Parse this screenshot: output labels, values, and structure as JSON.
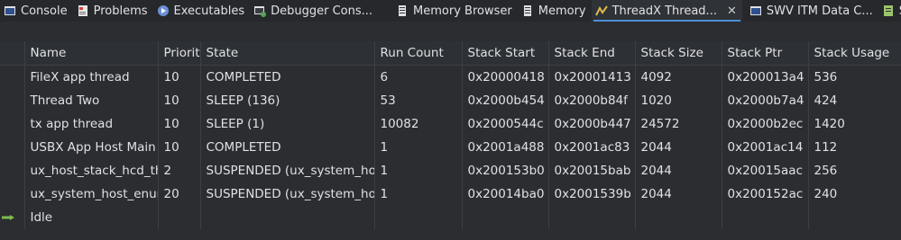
{
  "tabs": [
    {
      "label": "Console",
      "icon": "console-icon",
      "active": false
    },
    {
      "label": "Problems",
      "icon": "problems-icon",
      "active": false
    },
    {
      "label": "Executables",
      "icon": "executables-icon",
      "active": false
    },
    {
      "label": "Debugger Cons...",
      "icon": "debugger-console-icon",
      "active": false
    },
    {
      "label": "Memory Browser",
      "icon": "memory-browser-icon",
      "active": false
    },
    {
      "label": "Memory",
      "icon": "memory-icon",
      "active": false
    },
    {
      "label": "ThreadX Thread...",
      "icon": "threadx-icon",
      "active": true,
      "close": "✕"
    },
    {
      "label": "SWV ITM Data C...",
      "icon": "swv-itm-icon",
      "active": false
    },
    {
      "label": "S",
      "icon": "overflow-tab-icon",
      "active": false
    }
  ],
  "columns": [
    "Name",
    "Priority",
    "State",
    "Run Count",
    "Stack Start",
    "Stack End",
    "Stack Size",
    "Stack Ptr",
    "Stack Usage"
  ],
  "rows": [
    {
      "name": "FileX app thread",
      "priority": "10",
      "state": "COMPLETED",
      "run_count": "6",
      "stack_start": "0x20000418",
      "stack_end": "0x20001413",
      "stack_size": "4092",
      "stack_ptr": "0x200013a4",
      "stack_usage": "536",
      "current": false
    },
    {
      "name": "Thread Two",
      "priority": "10",
      "state": "SLEEP (136)",
      "run_count": "53",
      "stack_start": "0x2000b454",
      "stack_end": "0x2000b84f",
      "stack_size": "1020",
      "stack_ptr": "0x2000b7a4",
      "stack_usage": "424",
      "current": false
    },
    {
      "name": "tx app thread",
      "priority": "10",
      "state": "SLEEP (1)",
      "run_count": "10082",
      "stack_start": "0x2000544c",
      "stack_end": "0x2000b447",
      "stack_size": "24572",
      "stack_ptr": "0x2000b2ec",
      "stack_usage": "1420",
      "current": false
    },
    {
      "name": "USBX App Host Main",
      "priority": "10",
      "state": "COMPLETED",
      "run_count": "1",
      "stack_start": "0x2001a488",
      "stack_end": "0x2001ac83",
      "stack_size": "2044",
      "stack_ptr": "0x2001ac14",
      "stack_usage": "112",
      "current": false
    },
    {
      "name": "ux_host_stack_hcd_th",
      "priority": "2",
      "state": "SUSPENDED (ux_system_hos",
      "run_count": "1",
      "stack_start": "0x200153b0",
      "stack_end": "0x20015bab",
      "stack_size": "2044",
      "stack_ptr": "0x20015aac",
      "stack_usage": "256",
      "current": false
    },
    {
      "name": "ux_system_host_enun",
      "priority": "20",
      "state": "SUSPENDED (ux_system_hos",
      "run_count": "1",
      "stack_start": "0x20014ba0",
      "stack_end": "0x2001539b",
      "stack_size": "2044",
      "stack_ptr": "0x200152ac",
      "stack_usage": "240",
      "current": false
    },
    {
      "name": "Idle",
      "priority": "",
      "state": "",
      "run_count": "",
      "stack_start": "",
      "stack_end": "",
      "stack_size": "",
      "stack_ptr": "",
      "stack_usage": "",
      "current": true
    }
  ],
  "colors": {
    "current_thread_indicator": "#7dbb4f",
    "active_tab_underline": "#4a90d9"
  }
}
